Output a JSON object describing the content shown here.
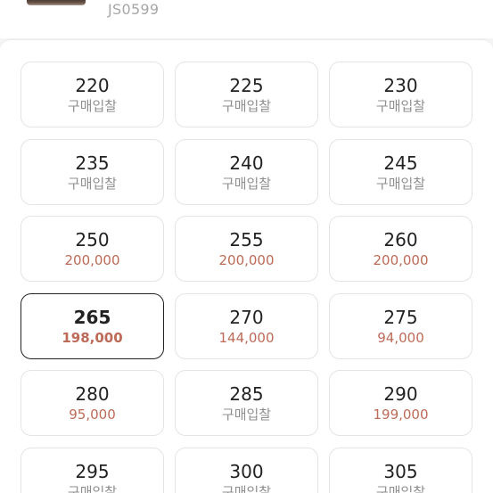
{
  "product": {
    "model_code": "JS0599"
  },
  "sizes": [
    {
      "size": "220",
      "price": "구매입찰"
    },
    {
      "size": "225",
      "price": "구매입찰"
    },
    {
      "size": "230",
      "price": "구매입찰"
    },
    {
      "size": "235",
      "price": "구매입찰"
    },
    {
      "size": "240",
      "price": "구매입찰"
    },
    {
      "size": "245",
      "price": "구매입찰"
    },
    {
      "size": "250",
      "price": "200,000"
    },
    {
      "size": "255",
      "price": "200,000"
    },
    {
      "size": "260",
      "price": "200,000"
    },
    {
      "size": "265",
      "price": "198,000"
    },
    {
      "size": "270",
      "price": "144,000"
    },
    {
      "size": "275",
      "price": "94,000"
    },
    {
      "size": "280",
      "price": "95,000"
    },
    {
      "size": "285",
      "price": "구매입찰"
    },
    {
      "size": "290",
      "price": "199,000"
    },
    {
      "size": "295",
      "price": "구매입찰"
    },
    {
      "size": "300",
      "price": "구매입찰"
    },
    {
      "size": "305",
      "price": "구매입찰"
    }
  ],
  "selected_size": "265",
  "colors": {
    "price": "#bd6a57",
    "bid": "#8f8f8f",
    "selected_border": "#222222"
  }
}
